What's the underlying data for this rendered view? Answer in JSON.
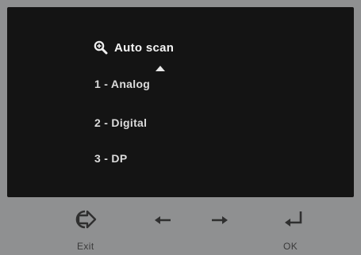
{
  "menu": {
    "title": "Auto scan",
    "title_icon": "magnifier-plus-icon",
    "scroll_icon": "triangle-up-icon",
    "options": [
      {
        "label": "1 - Analog"
      },
      {
        "label": "2 - Digital"
      },
      {
        "label": "3 - DP"
      }
    ]
  },
  "buttons": {
    "exit": {
      "icon": "exit-arrow-icon",
      "label": "Exit"
    },
    "left": {
      "icon": "arrow-left-icon"
    },
    "right": {
      "icon": "arrow-right-icon"
    },
    "ok": {
      "icon": "enter-return-icon",
      "label": "OK"
    }
  },
  "colors": {
    "panel_bg": "#141414",
    "bezel_bg": "#8f9091",
    "text": "#f4f4f4",
    "icon": "#2f2f2f"
  }
}
